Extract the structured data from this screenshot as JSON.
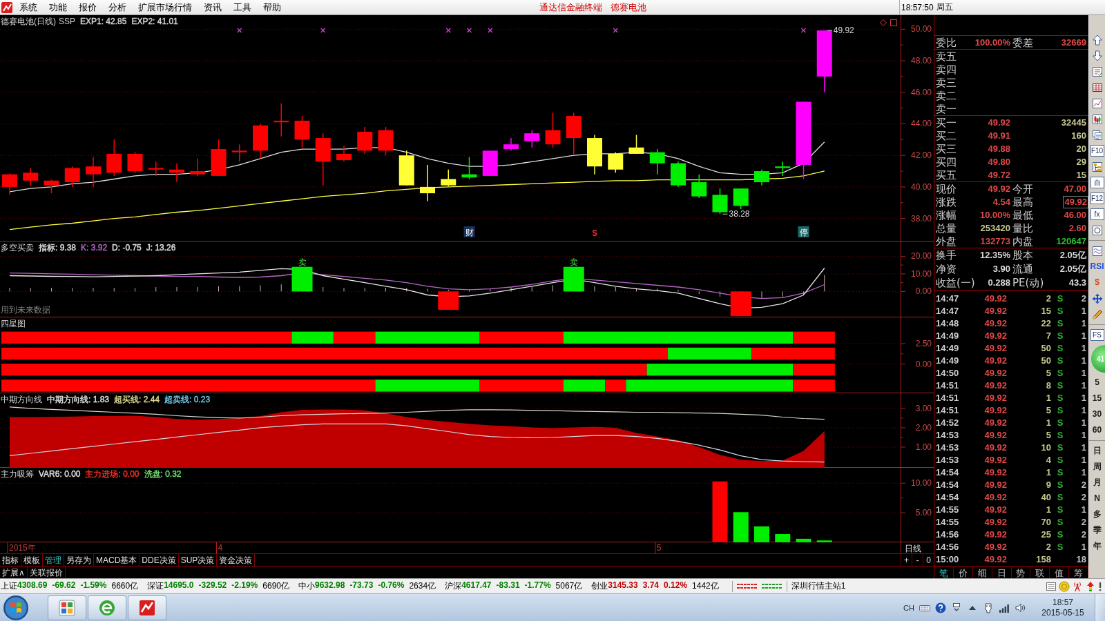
{
  "menu_bar": {
    "items": [
      "系统",
      "功能",
      "报价",
      "分析",
      "扩展市场行情",
      "资讯",
      "工具",
      "帮助"
    ],
    "title": "通达信金融终端",
    "stock": "德赛电池",
    "clock": "18:57:50",
    "weekday": "周五"
  },
  "panels": [
    {
      "kind": "kline",
      "title": "德赛电池(日线)",
      "subtitle": "SSP",
      "legend": [
        {
          "text": "EXP1: 42.85",
          "color": "#d8d8d8"
        },
        {
          "text": "EXP2: 41.01",
          "color": "#d8d8d8"
        }
      ],
      "axis_labels": [
        "50.00",
        "48.00",
        "46.00",
        "44.00",
        "42.00",
        "40.00",
        "38.00"
      ],
      "price_labels": [
        "49.92",
        "38.28"
      ],
      "info_marks": [
        {
          "kind": "tile",
          "text": "财",
          "color": "#18305a"
        },
        {
          "kind": "text",
          "text": "$",
          "color": "#d83030"
        },
        {
          "kind": "tile",
          "text": "停",
          "color": "#1e6868"
        }
      ]
    },
    {
      "kind": "signals",
      "title": "多空买卖",
      "legend": [
        {
          "text": "指标: 9.38",
          "color": "#e0e0e0"
        },
        {
          "text": "K: 3.92",
          "color": "#b868c8"
        },
        {
          "text": "D: -0.75",
          "color": "#e0e0e0"
        },
        {
          "text": "J: 13.26",
          "color": "#e0e0e0"
        }
      ],
      "axis_labels": [
        "20.00",
        "10.00",
        "0.00"
      ],
      "signal_labels": [
        "卖",
        "卖"
      ],
      "note": "用到未来数据"
    },
    {
      "kind": "bands",
      "title": "四星图",
      "axis_labels": [
        "2.50",
        "0.00"
      ]
    },
    {
      "kind": "area",
      "title": "中期方向线",
      "legend": [
        {
          "text": "中期方向线: 1.83",
          "color": "#e0e0e0"
        },
        {
          "text": "超买线: 2.44",
          "color": "#e0d890"
        },
        {
          "text": "超卖线: 0.23",
          "color": "#70c8e8"
        }
      ],
      "axis_labels": [
        "3.00",
        "2.00",
        "1.00"
      ]
    },
    {
      "kind": "bars",
      "title": "主力吸筹",
      "legend": [
        {
          "text": "VAR6: 0.00",
          "color": "#e0e0e0"
        },
        {
          "text": "主力进场: 0.00",
          "color": "#ff3020"
        },
        {
          "text": "洗盘: 0.32",
          "color": "#70e070"
        }
      ],
      "axis_labels": [
        "10.00",
        "5.00"
      ]
    }
  ],
  "date_axis": {
    "labels": [
      "2015年",
      "4",
      "5"
    ],
    "period": "日线"
  },
  "chart_tabs": {
    "tabs": [
      {
        "label": "指标",
        "selected": false
      },
      {
        "label": "模板",
        "selected": false
      },
      {
        "label": "管理",
        "selected": true
      },
      {
        "label": "另存为",
        "selected": false
      },
      {
        "label": "MACD基本",
        "selected": false
      },
      {
        "label": "DDE决策",
        "selected": false
      },
      {
        "label": "SUP决策",
        "selected": false
      },
      {
        "label": "资金决策",
        "selected": false
      }
    ],
    "controls": [
      "+",
      "-",
      "0"
    ]
  },
  "extra_tabs": [
    "扩展∧",
    "关联报价"
  ],
  "quote": {
    "order_ratio": [
      {
        "label": "委比",
        "value": "100.00%"
      },
      {
        "label": "委差",
        "value": "32669"
      }
    ],
    "asks": [
      {
        "label": "卖五"
      },
      {
        "label": "卖四"
      },
      {
        "label": "卖三"
      },
      {
        "label": "卖二"
      },
      {
        "label": "卖一"
      }
    ],
    "bids": [
      {
        "label": "买一",
        "price": "49.92",
        "volume": "32445"
      },
      {
        "label": "买二",
        "price": "49.91",
        "volume": "160"
      },
      {
        "label": "买三",
        "price": "49.88",
        "volume": "20"
      },
      {
        "label": "买四",
        "price": "49.80",
        "volume": "29"
      },
      {
        "label": "买五",
        "price": "49.72",
        "volume": "15"
      }
    ],
    "stats": [
      {
        "cells": [
          {
            "label": "现价",
            "value": "49.92",
            "color": "#e04848",
            "highlighted": false
          },
          {
            "label": "今开",
            "value": "47.00",
            "color": "#e04848",
            "highlighted": false
          }
        ]
      },
      {
        "cells": [
          {
            "label": "涨跌",
            "value": "4.54",
            "color": "#e04848",
            "highlighted": false
          },
          {
            "label": "最高",
            "value": "49.92",
            "color": "#e04848",
            "highlighted": true
          }
        ]
      },
      {
        "cells": [
          {
            "label": "涨幅",
            "value": "10.00%",
            "color": "#e04848",
            "highlighted": false
          },
          {
            "label": "最低",
            "value": "46.00",
            "color": "#e04848",
            "highlighted": false
          }
        ]
      },
      {
        "cells": [
          {
            "label": "总量",
            "value": "253420",
            "color": "#c8c890",
            "highlighted": false
          },
          {
            "label": "量比",
            "value": "2.60",
            "color": "#e04848",
            "highlighted": false
          }
        ]
      },
      {
        "cells": [
          {
            "label": "外盘",
            "value": "132773",
            "color": "#e04848",
            "highlighted": false
          },
          {
            "label": "内盘",
            "value": "120647",
            "color": "#30c030",
            "highlighted": false
          }
        ]
      }
    ],
    "fundamentals": [
      {
        "cells": [
          {
            "label": "换手",
            "value": "12.35%",
            "color": "#d8d8d8"
          },
          {
            "label": "股本",
            "value": "2.05亿",
            "color": "#d8d8d8"
          }
        ]
      },
      {
        "cells": [
          {
            "label": "净资",
            "value": "3.90",
            "color": "#d8d8d8"
          },
          {
            "label": "流通",
            "value": "2.05亿",
            "color": "#d8d8d8"
          }
        ]
      },
      {
        "cells": [
          {
            "label": "收益(一)",
            "value": "0.288",
            "color": "#d8d8d8"
          },
          {
            "label": "PE(动)",
            "value": "43.3",
            "color": "#d8d8d8"
          }
        ]
      }
    ],
    "trades": [
      {
        "time": "14:47",
        "price": "49.92",
        "volume": "2",
        "side": "S",
        "count": "2"
      },
      {
        "time": "14:47",
        "price": "49.92",
        "volume": "15",
        "side": "S",
        "count": "1"
      },
      {
        "time": "14:48",
        "price": "49.92",
        "volume": "22",
        "side": "S",
        "count": "1"
      },
      {
        "time": "14:49",
        "price": "49.92",
        "volume": "7",
        "side": "S",
        "count": "1"
      },
      {
        "time": "14:49",
        "price": "49.92",
        "volume": "50",
        "side": "S",
        "count": "1"
      },
      {
        "time": "14:49",
        "price": "49.92",
        "volume": "50",
        "side": "S",
        "count": "1"
      },
      {
        "time": "14:50",
        "price": "49.92",
        "volume": "5",
        "side": "S",
        "count": "1"
      },
      {
        "time": "14:51",
        "price": "49.92",
        "volume": "8",
        "side": "S",
        "count": "1"
      },
      {
        "time": "14:51",
        "price": "49.92",
        "volume": "1",
        "side": "S",
        "count": "1"
      },
      {
        "time": "14:51",
        "price": "49.92",
        "volume": "5",
        "side": "S",
        "count": "1"
      },
      {
        "time": "14:52",
        "price": "49.92",
        "volume": "1",
        "side": "S",
        "count": "1"
      },
      {
        "time": "14:53",
        "price": "49.92",
        "volume": "5",
        "side": "S",
        "count": "1"
      },
      {
        "time": "14:53",
        "price": "49.92",
        "volume": "10",
        "side": "S",
        "count": "1"
      },
      {
        "time": "14:53",
        "price": "49.92",
        "volume": "4",
        "side": "S",
        "count": "1"
      },
      {
        "time": "14:54",
        "price": "49.92",
        "volume": "1",
        "side": "S",
        "count": "1"
      },
      {
        "time": "14:54",
        "price": "49.92",
        "volume": "9",
        "side": "S",
        "count": "2"
      },
      {
        "time": "14:54",
        "price": "49.92",
        "volume": "40",
        "side": "S",
        "count": "2"
      },
      {
        "time": "14:55",
        "price": "49.92",
        "volume": "1",
        "side": "S",
        "count": "1"
      },
      {
        "time": "14:55",
        "price": "49.92",
        "volume": "70",
        "side": "S",
        "count": "2"
      },
      {
        "time": "14:56",
        "price": "49.92",
        "volume": "25",
        "side": "S",
        "count": "2"
      },
      {
        "time": "14:56",
        "price": "49.92",
        "volume": "2",
        "side": "S",
        "count": "1"
      },
      {
        "time": "15:00",
        "price": "49.92",
        "volume": "158",
        "count": "18"
      }
    ],
    "tabs": [
      {
        "label": "笔",
        "selected": true
      },
      {
        "label": "价",
        "selected": false
      },
      {
        "label": "细",
        "selected": false
      },
      {
        "label": "日",
        "selected": false
      },
      {
        "label": "势",
        "selected": false
      },
      {
        "label": "联",
        "selected": false
      },
      {
        "label": "值",
        "selected": false
      },
      {
        "label": "筹",
        "selected": false
      }
    ]
  },
  "toolbar": [
    {
      "items": [
        {
          "kind": "up"
        },
        {
          "kind": "down"
        },
        {
          "kind": "report"
        },
        {
          "kind": "table"
        },
        {
          "kind": "trend"
        },
        {
          "kind": "candles"
        },
        {
          "kind": "windows"
        },
        {
          "kind": "key",
          "label": "F10"
        },
        {
          "kind": "tree"
        },
        {
          "kind": "key",
          "label": "自"
        },
        {
          "kind": "key",
          "label": "F12"
        },
        {
          "kind": "key",
          "label": "fx"
        },
        {
          "kind": "ring"
        }
      ]
    },
    {
      "items": [
        {
          "kind": "wave"
        },
        {
          "kind": "text",
          "label": "RSI",
          "color": "#2050e0"
        },
        {
          "kind": "text",
          "label": "$",
          "color": "#e04020"
        },
        {
          "kind": "move"
        },
        {
          "kind": "pencil"
        }
      ]
    },
    {
      "items": [
        {
          "kind": "key",
          "label": "FS"
        },
        {
          "kind": "ball",
          "label": "41"
        },
        {
          "kind": "text",
          "label": "5",
          "color": "#202020"
        },
        {
          "kind": "text",
          "label": "15",
          "color": "#202020"
        },
        {
          "kind": "text",
          "label": "30",
          "color": "#202020"
        },
        {
          "kind": "text",
          "label": "60",
          "color": "#202020"
        }
      ]
    },
    {
      "items": [
        {
          "kind": "text",
          "label": "日",
          "color": "#202020"
        },
        {
          "kind": "text",
          "label": "周",
          "color": "#202020"
        },
        {
          "kind": "text",
          "label": "月",
          "color": "#202020"
        },
        {
          "kind": "text",
          "label": "N",
          "color": "#202020"
        },
        {
          "kind": "text",
          "label": "多",
          "color": "#202020"
        },
        {
          "kind": "text",
          "label": "季",
          "color": "#202020"
        },
        {
          "kind": "text",
          "label": "年",
          "color": "#202020"
        }
      ]
    }
  ],
  "status_bar": {
    "indices": [
      {
        "name": "上证",
        "value": "4308.69",
        "change": "-69.62",
        "percent": "-1.59%",
        "amount": "6660亿",
        "color": "#008000"
      },
      {
        "name": "深证",
        "value": "14695.0",
        "change": "-329.52",
        "percent": "-2.19%",
        "amount": "6690亿",
        "color": "#008000"
      },
      {
        "name": "中小",
        "value": "9632.98",
        "change": "-73.73",
        "percent": "-0.76%",
        "amount": "2634亿",
        "color": "#008000"
      },
      {
        "name": "沪深",
        "value": "4617.47",
        "change": "-83.31",
        "percent": "-1.77%",
        "amount": "5067亿",
        "color": "#008000"
      },
      {
        "name": "创业",
        "value": "3145.33",
        "change": "3.74",
        "percent": "0.12%",
        "amount": "1442亿",
        "color": "#c00000"
      }
    ],
    "server": "深圳行情主站1"
  },
  "taskbar": {
    "language": "CH",
    "time": "18:57",
    "date": "2015-05-15"
  }
}
